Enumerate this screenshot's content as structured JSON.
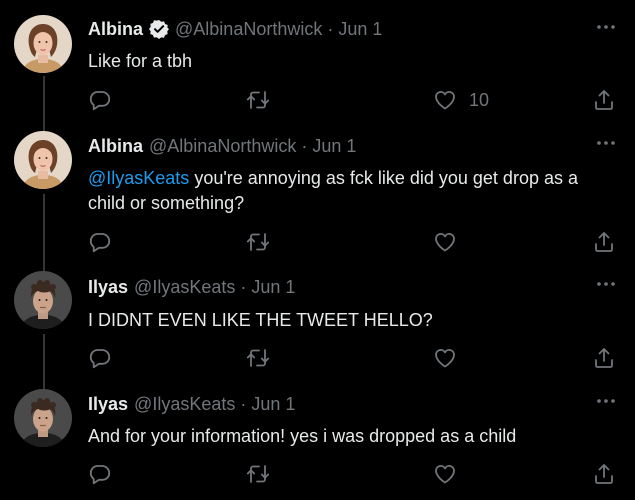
{
  "colors": {
    "background": "#000000",
    "text": "#e7e9ea",
    "muted": "#71767b",
    "link": "#1d9bf0",
    "thread_line": "#333639"
  },
  "tweets": [
    {
      "name": "Albina",
      "verified": true,
      "handle": "@AlbinaNorthwick",
      "separator": "·",
      "date": "Jun 1",
      "text": "Like for a  tbh",
      "like_count": "10",
      "avatar": "woman-portrait-avatar"
    },
    {
      "name": "Albina",
      "verified": false,
      "handle": "@AlbinaNorthwick",
      "separator": "·",
      "date": "Jun 1",
      "mention": "@IlyasKeats",
      "text": " you're annoying as fck like did you get drop as a child or something?",
      "avatar": "woman-portrait-avatar"
    },
    {
      "name": "Ilyas",
      "verified": false,
      "handle": "@IlyasKeats",
      "separator": "·",
      "date": "Jun 1",
      "text": "I DIDNT EVEN LIKE THE TWEET HELLO?",
      "avatar": "man-portrait-avatar"
    },
    {
      "name": "Ilyas",
      "verified": false,
      "handle": "@IlyasKeats",
      "separator": "·",
      "date": "Jun 1",
      "text": "And for your information! yes i was dropped as a child",
      "avatar": "man-portrait-avatar"
    }
  ],
  "icons": {
    "reply": "reply-icon",
    "retweet": "retweet-icon",
    "like": "heart-icon",
    "share": "share-icon",
    "more": "more-icon"
  }
}
